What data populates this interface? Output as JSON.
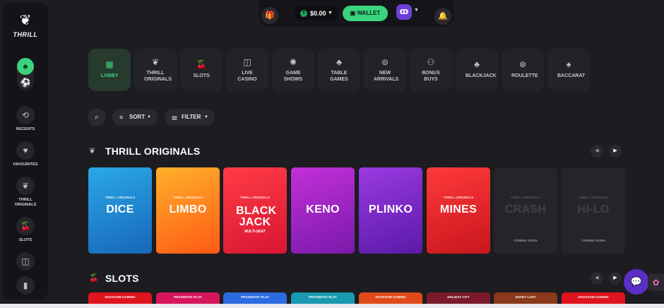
{
  "brand": {
    "name": "THRILL",
    "mark": "❦"
  },
  "sidebar": {
    "toggle": {
      "on_icon": "♠",
      "off_icon": "⚽"
    },
    "items": [
      {
        "label": "RECENTS",
        "icon": "⟲"
      },
      {
        "label": "FAVOURITES",
        "icon": "♥"
      },
      {
        "label": "THRILL ORIGINALS",
        "icon": "❦"
      },
      {
        "label": "SLOTS",
        "icon": "🍒"
      },
      {
        "label": "",
        "icon": "◫"
      },
      {
        "label": "",
        "icon": "▮"
      }
    ]
  },
  "topbar": {
    "gift_icon": "🎁",
    "balance": "$0.00",
    "coin_symbol": "T",
    "wallet_label": "WALLET",
    "bell_icon": "🔔"
  },
  "categories": [
    {
      "label": "LOBBY",
      "icon": "▦",
      "active": true
    },
    {
      "label": "THRILL ORIGINALS",
      "icon": "❦",
      "active": false
    },
    {
      "label": "SLOTS",
      "icon": "🍒",
      "active": false
    },
    {
      "label": "LIVE CASINO",
      "icon": "◫",
      "active": false
    },
    {
      "label": "GAME SHOWS",
      "icon": "✺",
      "active": false
    },
    {
      "label": "TABLE GAMES",
      "icon": "♣",
      "active": false
    },
    {
      "label": "NEW ARRIVALS",
      "icon": "⊜",
      "active": false
    },
    {
      "label": "BONUS BUYS",
      "icon": "⚇",
      "active": false
    },
    {
      "label": "BLACKJACK",
      "icon": "♣",
      "active": false
    },
    {
      "label": "ROULETTE",
      "icon": "⊛",
      "active": false
    },
    {
      "label": "BACCARAT",
      "icon": "♠",
      "active": false
    }
  ],
  "filters": {
    "search_icon": "⌕",
    "sort_label": "SORT",
    "filter_label": "FILTER"
  },
  "originals": {
    "title": "THRILL ORIGINALS",
    "cards": [
      {
        "tag": "THRILL ORIGINALS",
        "name": "DICE",
        "sub": "",
        "soon": "",
        "bg": "linear-gradient(160deg,#2aa8e8,#1767b8)"
      },
      {
        "tag": "THRILL ORIGINALS",
        "name": "LIMBO",
        "sub": "",
        "soon": "",
        "bg": "linear-gradient(160deg,#ffb02a,#ff5a14)"
      },
      {
        "tag": "THRILL ORIGINALS",
        "name": "BLACK JACK",
        "sub": "MULTI-SEAT",
        "soon": "",
        "bg": "linear-gradient(160deg,#ff3c45,#d81632)"
      },
      {
        "tag": "",
        "name": "KENO",
        "sub": "",
        "soon": "",
        "bg": "linear-gradient(160deg,#c230d8,#7a1aaa)"
      },
      {
        "tag": "",
        "name": "PLINKO",
        "sub": "",
        "soon": "",
        "bg": "linear-gradient(160deg,#9a3ae0,#5a1aa8)"
      },
      {
        "tag": "THRILL ORIGINALS",
        "name": "MINES",
        "sub": "",
        "soon": "",
        "bg": "linear-gradient(160deg,#ff3a3a,#c8161d)"
      },
      {
        "tag": "THRILL ORIGINALS",
        "name": "CRASH",
        "sub": "",
        "soon": "COMING SOON",
        "bg": "#25242a"
      },
      {
        "tag": "THRILL ORIGINALS",
        "name": "HI-LO",
        "sub": "",
        "soon": "COMING SOON",
        "bg": "#25242a"
      }
    ]
  },
  "slots": {
    "title": "SLOTS",
    "providers": [
      {
        "name": "HACKSAW GAMING",
        "bg": "#e0141e"
      },
      {
        "name": "PRAGMATIC PLAY",
        "bg": "#d6165a"
      },
      {
        "name": "PRAGMATIC PLAY",
        "bg": "#2b6be0"
      },
      {
        "name": "PRAGMATIC PLAY",
        "bg": "#1a9ab0"
      },
      {
        "name": "HACKSAW GAMING",
        "bg": "#e04a1a"
      },
      {
        "name": "HOLIDAY CITY",
        "bg": "#7a1a2a"
      },
      {
        "name": "SHADY LADY",
        "bg": "#8a3a1a"
      },
      {
        "name": "HACKSAW GAMING",
        "bg": "#e0141e"
      }
    ]
  },
  "chat": {
    "icon": "💬",
    "side_icon": "✿"
  }
}
